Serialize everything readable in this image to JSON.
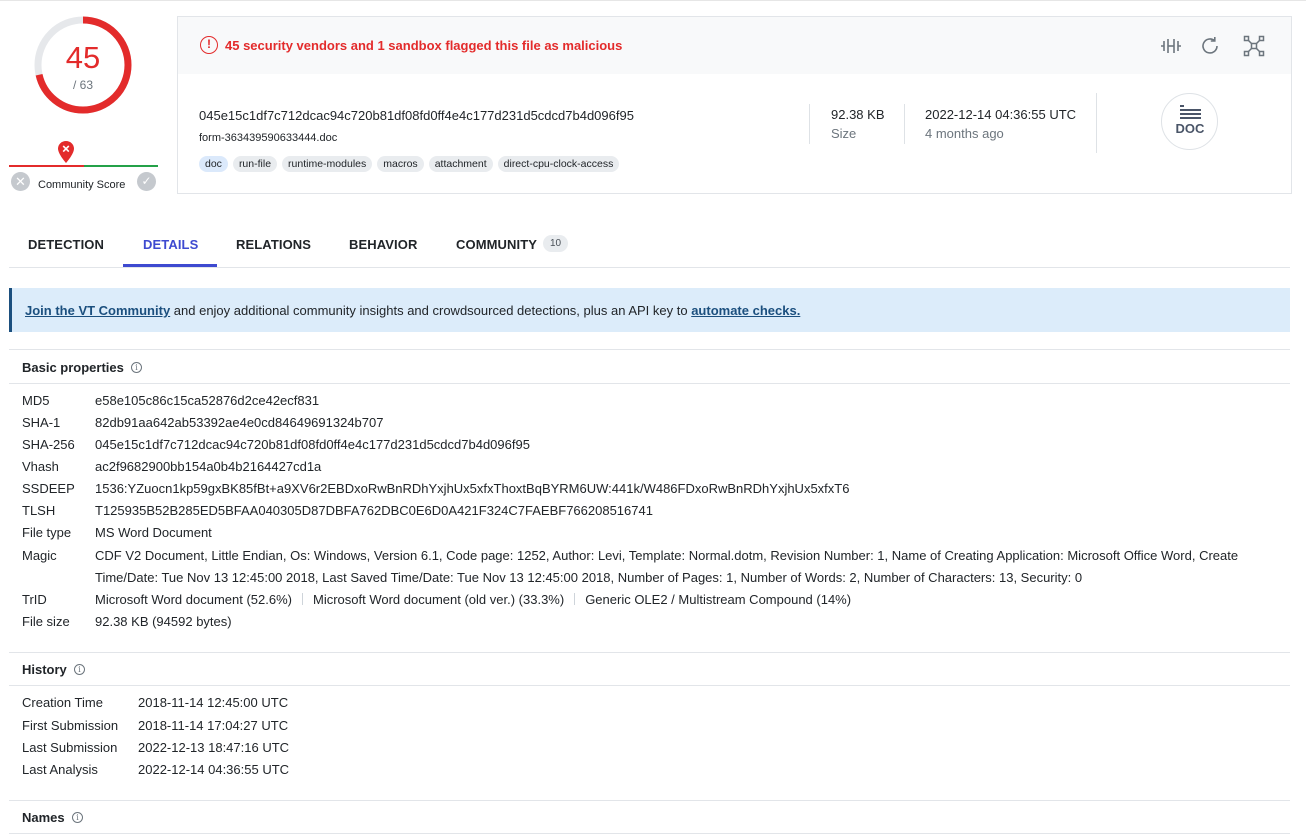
{
  "score": {
    "value": "45",
    "total": "/ 63",
    "fraction": 0.714,
    "color": "#e32b2b"
  },
  "community": {
    "label": "Community Score"
  },
  "alert": {
    "text": "45 security vendors and 1 sandbox flagged this file as malicious"
  },
  "file": {
    "hash": "045e15c1df7c712dcac94c720b81df08fd0ff4e4c177d231d5cdcd7b4d096f95",
    "name": "form-363439590633444.doc",
    "tags": [
      "doc",
      "run-file",
      "runtime-modules",
      "macros",
      "attachment",
      "direct-cpu-clock-access"
    ],
    "size_value": "92.38 KB",
    "size_label": "Size",
    "date_value": "2022-12-14 04:36:55 UTC",
    "date_ago": "4 months ago",
    "type_badge": "DOC"
  },
  "toolbar_icons": [
    "compare-icon",
    "reanalyze-icon",
    "graph-icon"
  ],
  "tabs": [
    {
      "label": "DETECTION"
    },
    {
      "label": "DETAILS"
    },
    {
      "label": "RELATIONS"
    },
    {
      "label": "BEHAVIOR"
    },
    {
      "label": "COMMUNITY",
      "count": "10"
    }
  ],
  "banner": {
    "link1": "Join the VT Community",
    "middle": " and enjoy additional community insights and crowdsourced detections, plus an API key to ",
    "link2": "automate checks."
  },
  "basic": {
    "title": "Basic properties",
    "rows": [
      {
        "label": "MD5",
        "value": "e58e105c86c15ca52876d2ce42ecf831"
      },
      {
        "label": "SHA-1",
        "value": "82db91aa642ab53392ae4e0cd84649691324b707"
      },
      {
        "label": "SHA-256",
        "value": "045e15c1df7c712dcac94c720b81df08fd0ff4e4c177d231d5cdcd7b4d096f95"
      },
      {
        "label": "Vhash",
        "value": "ac2f9682900bb154a0b4b2164427cd1a"
      },
      {
        "label": "SSDEEP",
        "value": "1536:YZuocn1kp59gxBK85fBt+a9XV6r2EBDxoRwBnRDhYxjhUx5xfxThoxtBqBYRM6UW:441k/W486FDxoRwBnRDhYxjhUx5xfxT6"
      },
      {
        "label": "TLSH",
        "value": "T125935B52B285ED5BFAA040305D87DBFA762DBC0E6D0A421F324C7FAEBF766208516741"
      },
      {
        "label": "File type",
        "value": "MS Word Document"
      },
      {
        "label": "Magic",
        "value": "CDF V2 Document, Little Endian, Os: Windows, Version 6.1, Code page: 1252, Author: Levi, Template: Normal.dotm, Revision Number: 1, Name of Creating Application: Microsoft Office Word, Create",
        "value2": "Time/Date: Tue Nov 13 12:45:00 2018, Last Saved Time/Date: Tue Nov 13 12:45:00 2018, Number of Pages: 1, Number of Words: 2, Number of Characters: 13, Security: 0"
      },
      {
        "label": "TrID",
        "values": [
          "Microsoft Word document (52.6%)",
          "Microsoft Word document (old ver.) (33.3%)",
          "Generic OLE2 / Multistream Compound (14%)"
        ]
      },
      {
        "label": "File size",
        "value": "92.38 KB (94592 bytes)"
      }
    ]
  },
  "history": {
    "title": "History",
    "rows": [
      {
        "label": "Creation Time",
        "value": "2018-11-14 12:45:00 UTC"
      },
      {
        "label": "First Submission",
        "value": "2018-11-14 17:04:27 UTC"
      },
      {
        "label": "Last Submission",
        "value": "2022-12-13 18:47:16 UTC"
      },
      {
        "label": "Last Analysis",
        "value": "2022-12-14 04:36:55 UTC"
      }
    ]
  },
  "names": {
    "title": "Names"
  }
}
